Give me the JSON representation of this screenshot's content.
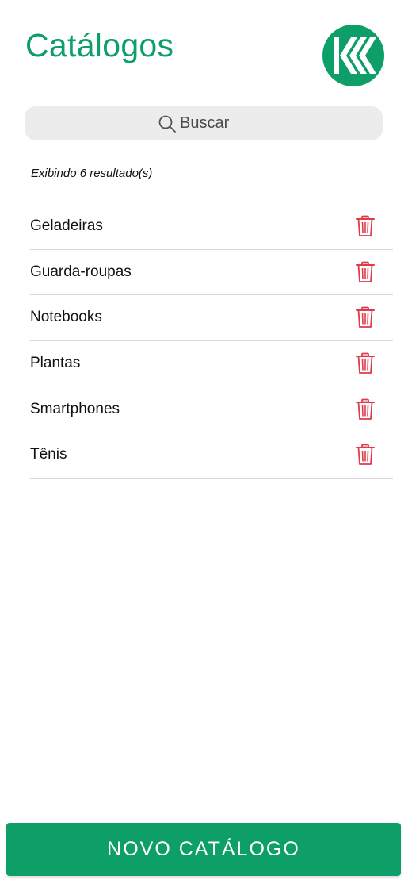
{
  "header": {
    "title": "Catálogos",
    "logo_icon": "kk-logo-icon"
  },
  "search": {
    "placeholder": "Buscar",
    "value": "",
    "icon": "search-icon"
  },
  "results": {
    "count_text": "Exibindo 6 resultado(s)"
  },
  "catalogs": [
    {
      "label": "Geladeiras"
    },
    {
      "label": "Guarda-roupas"
    },
    {
      "label": "Notebooks"
    },
    {
      "label": "Plantas"
    },
    {
      "label": "Smartphones"
    },
    {
      "label": "Tênis"
    }
  ],
  "actions": {
    "delete_icon": "trash-icon",
    "new_catalog_label": "NOVO CATÁLOGO"
  },
  "colors": {
    "brand": "#0e9e68",
    "delete": "#e03a4b",
    "search_bg": "#ececec",
    "divider": "#d9d9d9"
  }
}
